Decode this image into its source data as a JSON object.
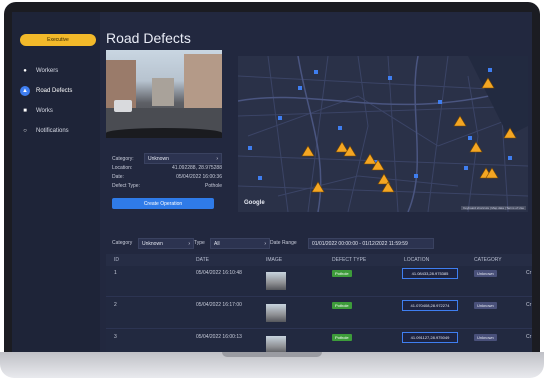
{
  "sidebar": {
    "brand": "Executive",
    "items": [
      {
        "label": "Workers",
        "icon": "user-icon",
        "active": false
      },
      {
        "label": "Road Defects",
        "icon": "warning-icon",
        "active": true
      },
      {
        "label": "Works",
        "icon": "truck-icon",
        "active": false
      },
      {
        "label": "Notifications",
        "icon": "bell-icon",
        "active": false
      }
    ]
  },
  "header": {
    "title": "Road Defects"
  },
  "detail": {
    "category_label": "Category:",
    "category_value": "Unknown",
    "location_label": "Location:",
    "location_value": "41.092288, 28.975288",
    "date_label": "Date:",
    "date_value": "05/04/2022 16:00:36",
    "defect_type_label": "Defect Type:",
    "defect_type_value": "Pothole",
    "create_button": "Create Operation"
  },
  "map": {
    "brand": "Google",
    "attribution": "Keyboard shortcuts | Map data | Terms of Use"
  },
  "filters": {
    "category_label": "Category",
    "category_value": "Unknown",
    "type_label": "Type",
    "type_value": "All",
    "date_range_label": "Date Range",
    "date_range_value": "01/01/2022 00:00:00 - 01/12/2022 11:59:59"
  },
  "table": {
    "columns": [
      "ID",
      "DATE",
      "IMAGE",
      "DEFECT TYPE",
      "LOCATION",
      "CATEGORY"
    ],
    "rows": [
      {
        "id": "1",
        "date": "05/04/2022 16:10:48",
        "defect": "Pothole",
        "location": "41.08433,28.975385",
        "category": "Unknown",
        "extra": "Cr"
      },
      {
        "id": "2",
        "date": "05/04/2022 16:17:00",
        "defect": "Pothole",
        "location": "41.070408,28.972274",
        "category": "Unknown",
        "extra": "Cr"
      },
      {
        "id": "3",
        "date": "05/04/2022 16:00:13",
        "defect": "Pothole",
        "location": "41.091127,28.975049",
        "category": "Unknown",
        "extra": "Cr"
      }
    ]
  },
  "colors": {
    "accent": "#3f7ef0",
    "brand": "#f2b92a",
    "pothole_tag": "#3d9c3a",
    "warning_marker": "#f4a623"
  }
}
